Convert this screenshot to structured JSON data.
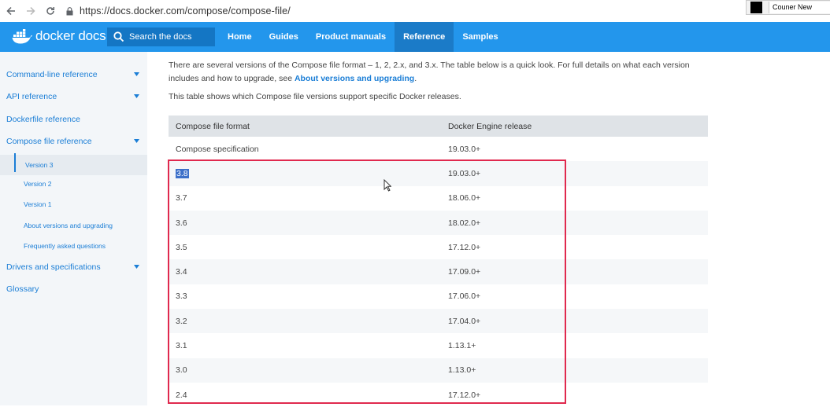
{
  "browser": {
    "url": "https://docs.docker.com/compose/compose-file/",
    "font_widget": "Couner New"
  },
  "header": {
    "logo_text": "docker docs",
    "search_placeholder": "Search the docs",
    "nav": [
      "Home",
      "Guides",
      "Product manuals",
      "Reference",
      "Samples"
    ],
    "active_nav": "Reference",
    "brand_color": "#2396ec"
  },
  "sidebar": {
    "items": [
      {
        "label": "Command-line reference",
        "expandable": true
      },
      {
        "label": "API reference",
        "expandable": true
      },
      {
        "label": "Dockerfile reference",
        "expandable": false
      },
      {
        "label": "Compose file reference",
        "expandable": true
      },
      {
        "label": "Version 3",
        "sub": true,
        "current": true
      },
      {
        "label": "Version 2",
        "sub": true
      },
      {
        "label": "Version 1",
        "sub": true
      },
      {
        "label": "About versions and upgrading",
        "sub": true
      },
      {
        "label": "Frequently asked questions",
        "sub": true
      },
      {
        "label": "Drivers and specifications",
        "expandable": true
      },
      {
        "label": "Glossary",
        "expandable": false
      }
    ]
  },
  "content": {
    "intro_text": "There are several versions of the Compose file format – 1, 2, 2.x, and 3.x. The table below is a quick look. For full details on what each version includes and how to upgrade, see ",
    "intro_link": "About versions and upgrading",
    "intro_end": ".",
    "table_intro": "This table shows which Compose file versions support specific Docker releases.",
    "table": {
      "headers": [
        "Compose file format",
        "Docker Engine release"
      ],
      "rows": [
        [
          "Compose specification",
          "19.03.0+"
        ],
        [
          "3.8",
          "19.03.0+"
        ],
        [
          "3.7",
          "18.06.0+"
        ],
        [
          "3.6",
          "18.02.0+"
        ],
        [
          "3.5",
          "17.12.0+"
        ],
        [
          "3.4",
          "17.09.0+"
        ],
        [
          "3.3",
          "17.06.0+"
        ],
        [
          "3.2",
          "17.04.0+"
        ],
        [
          "3.1",
          "1.13.1+"
        ],
        [
          "3.0",
          "1.13.0+"
        ],
        [
          "2.4",
          "17.12.0+"
        ]
      ],
      "selected_cell": "3.8"
    },
    "highlight_color": "#e0294e"
  }
}
